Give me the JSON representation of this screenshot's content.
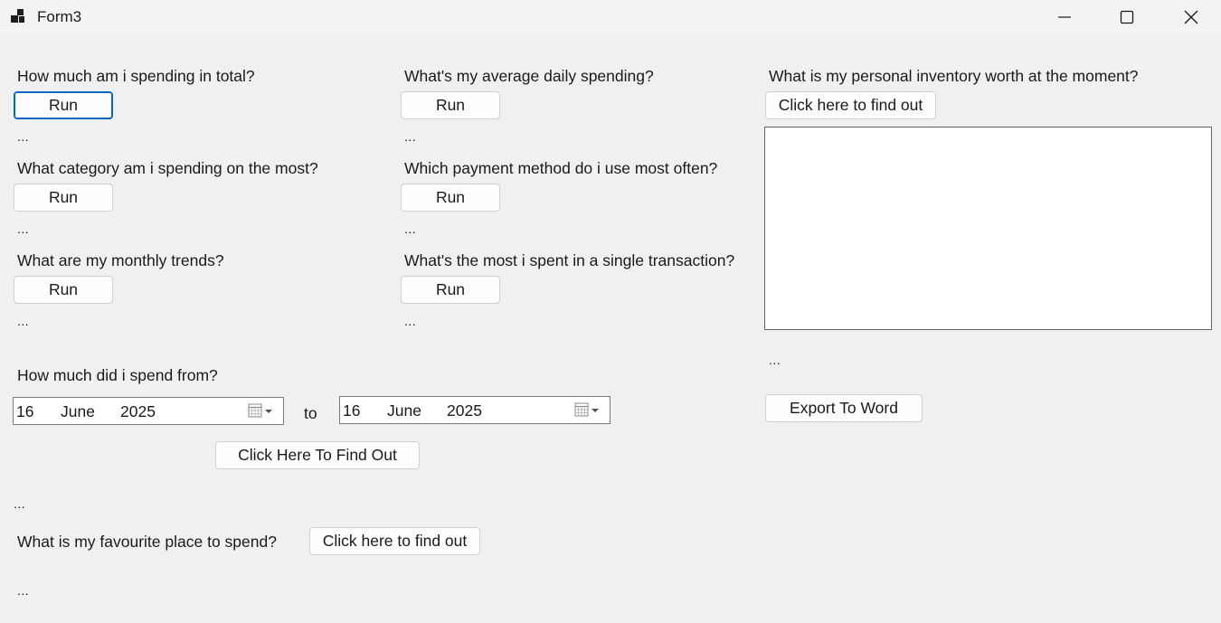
{
  "window": {
    "title": "Form3",
    "app_icon": "app-window-icon",
    "controls": [
      "minimize-icon",
      "maximize-icon",
      "close-icon"
    ]
  },
  "questions": {
    "q_total": {
      "label": "How much am i spending in total?",
      "button": "Run",
      "result": "..."
    },
    "q_avg_daily": {
      "label": "What's my average daily spending?",
      "button": "Run",
      "result": "..."
    },
    "q_category": {
      "label": "What category am i spending on the most?",
      "button": "Run",
      "result": "..."
    },
    "q_payment": {
      "label": "Which payment method do i use most often?",
      "button": "Run",
      "result": "..."
    },
    "q_monthly": {
      "label": "What are my monthly trends?",
      "button": "Run",
      "result": "..."
    },
    "q_max_txn": {
      "label": "What's the most i spent in a single transaction?",
      "button": "Run",
      "result": "..."
    }
  },
  "date_range": {
    "label": "How much did i spend from?",
    "from": {
      "day": "16",
      "month": "June",
      "year": "2025"
    },
    "separator": "to",
    "to": {
      "day": "16",
      "month": "June",
      "year": "2025"
    },
    "button": "Click Here To Find Out",
    "result": "..."
  },
  "favourite_place": {
    "label": "What is my favourite place to spend?",
    "button": "Click here to find out",
    "result": "..."
  },
  "inventory": {
    "label": "What is my personal inventory worth at the moment?",
    "button": "Click here to find out",
    "textbox_value": "",
    "result": "...",
    "export_button": "Export To Word"
  },
  "colors": {
    "background": "#f0f0f0",
    "button_face": "#fdfdfd",
    "button_border": "#d0d0d0",
    "focus_accent": "#0067c0"
  }
}
